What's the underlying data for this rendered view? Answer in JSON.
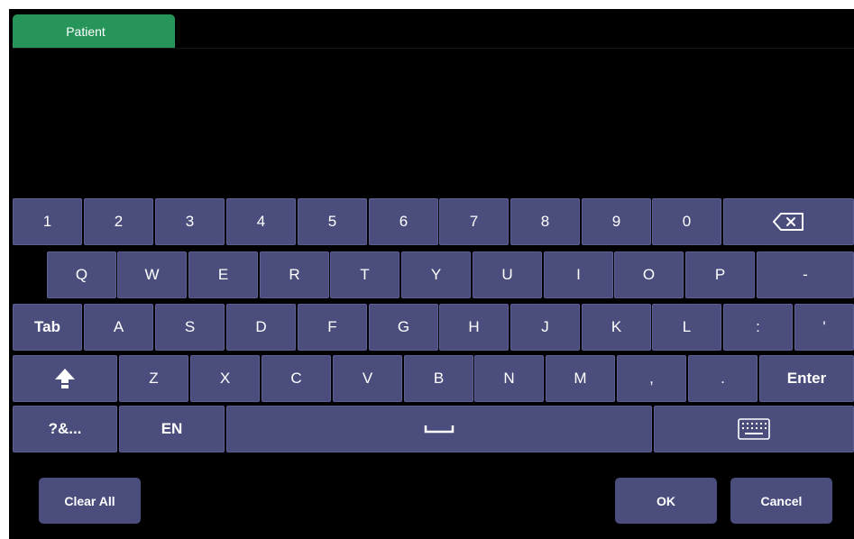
{
  "tabs": [
    {
      "label": "Patient",
      "active": true
    }
  ],
  "colors": {
    "tab_active": "#27955a",
    "key_bg": "#4b4e7d",
    "background": "#000000",
    "text": "#ffffff"
  },
  "keyboard": {
    "language": "EN",
    "rows": [
      [
        {
          "name": "key-1",
          "label": "1"
        },
        {
          "name": "key-2",
          "label": "2"
        },
        {
          "name": "key-3",
          "label": "3"
        },
        {
          "name": "key-4",
          "label": "4"
        },
        {
          "name": "key-5",
          "label": "5"
        },
        {
          "name": "key-6",
          "label": "6"
        },
        {
          "name": "key-7",
          "label": "7"
        },
        {
          "name": "key-8",
          "label": "8"
        },
        {
          "name": "key-9",
          "label": "9"
        },
        {
          "name": "key-0",
          "label": "0"
        },
        {
          "name": "backspace-key",
          "icon": "backspace-icon"
        }
      ],
      [
        {
          "name": "key-q",
          "label": "Q"
        },
        {
          "name": "key-w",
          "label": "W"
        },
        {
          "name": "key-e",
          "label": "E"
        },
        {
          "name": "key-r",
          "label": "R"
        },
        {
          "name": "key-t",
          "label": "T"
        },
        {
          "name": "key-y",
          "label": "Y"
        },
        {
          "name": "key-u",
          "label": "U"
        },
        {
          "name": "key-i",
          "label": "I"
        },
        {
          "name": "key-o",
          "label": "O"
        },
        {
          "name": "key-p",
          "label": "P"
        },
        {
          "name": "key-hyphen",
          "label": "-"
        }
      ],
      [
        {
          "name": "tab-key",
          "label": "Tab",
          "bold": true
        },
        {
          "name": "key-a",
          "label": "A"
        },
        {
          "name": "key-s",
          "label": "S"
        },
        {
          "name": "key-d",
          "label": "D"
        },
        {
          "name": "key-f",
          "label": "F"
        },
        {
          "name": "key-g",
          "label": "G"
        },
        {
          "name": "key-h",
          "label": "H"
        },
        {
          "name": "key-j",
          "label": "J"
        },
        {
          "name": "key-k",
          "label": "K"
        },
        {
          "name": "key-l",
          "label": "L"
        },
        {
          "name": "key-colon",
          "label": ":"
        },
        {
          "name": "key-apostrophe",
          "label": "'"
        }
      ],
      [
        {
          "name": "shift-key",
          "icon": "shift-arrow-icon"
        },
        {
          "name": "key-z",
          "label": "Z"
        },
        {
          "name": "key-x",
          "label": "X"
        },
        {
          "name": "key-c",
          "label": "C"
        },
        {
          "name": "key-v",
          "label": "V"
        },
        {
          "name": "key-b",
          "label": "B"
        },
        {
          "name": "key-n",
          "label": "N"
        },
        {
          "name": "key-m",
          "label": "M"
        },
        {
          "name": "key-comma",
          "label": ","
        },
        {
          "name": "key-period",
          "label": "."
        },
        {
          "name": "enter-key",
          "label": "Enter",
          "bold": true
        }
      ],
      [
        {
          "name": "symbols-key",
          "label": "?&...",
          "bold": true
        },
        {
          "name": "language-key",
          "label": "EN",
          "bold": true
        },
        {
          "name": "space-key",
          "icon": "space-bar-icon"
        },
        {
          "name": "hide-keyboard-key",
          "icon": "keyboard-icon"
        }
      ]
    ]
  },
  "actions": {
    "clear_all": "Clear All",
    "ok": "OK",
    "cancel": "Cancel"
  }
}
